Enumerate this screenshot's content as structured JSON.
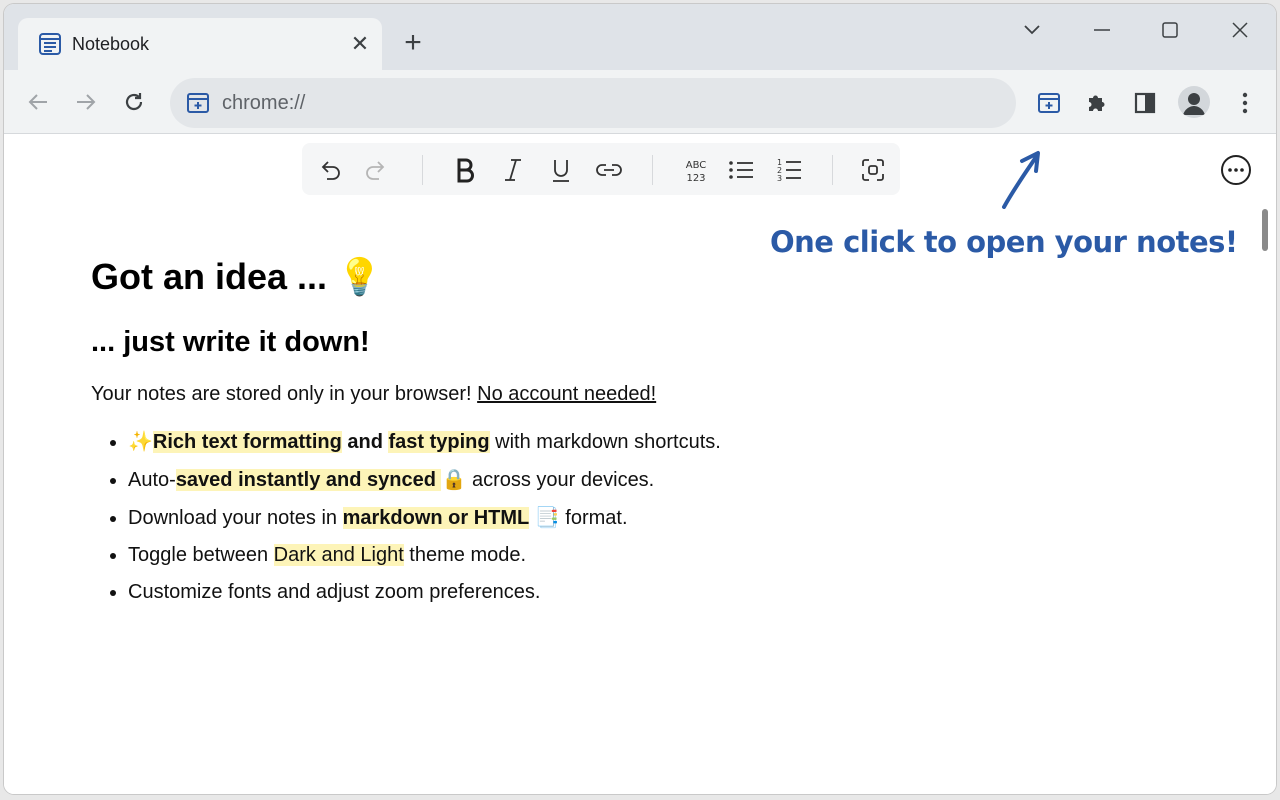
{
  "tab": {
    "title": "Notebook",
    "close_glyph": "✕",
    "new_tab_glyph": "+"
  },
  "omnibox": {
    "url": "chrome://"
  },
  "annotation": {
    "text": "One click to open your notes!"
  },
  "doc": {
    "heading1": "Got an idea ...",
    "heading1_emoji": "💡",
    "heading2": "... just write it down!",
    "paragraph_text": "Your notes are stored only in your browser! ",
    "paragraph_link": "No account needed!",
    "bullets": [
      {
        "emoji": "✨",
        "bold1": "Rich text formatting",
        "and": " and ",
        "bold2": "fast typing",
        "tail": " with markdown shortcuts."
      },
      {
        "lead": "Auto-",
        "bold": "saved instantly and synced",
        "emoji": "🔒",
        "tail": " across your devices."
      },
      {
        "lead": "Download your notes in ",
        "bold": "markdown or HTML",
        "emoji": "📑",
        "tail": " format."
      },
      {
        "lead": "Toggle between ",
        "hl": "Dark and Light",
        "tail": " theme mode."
      },
      {
        "text": "Customize fonts and adjust zoom preferences."
      }
    ]
  },
  "editor_toolbar": {
    "items": [
      "undo-icon",
      "redo-icon",
      "bold-icon",
      "italic-icon",
      "underline-icon",
      "link-icon",
      "spellcheck-icon",
      "bulleted-list-icon",
      "numbered-list-icon",
      "focus-mode-icon"
    ],
    "spellcheck_top": "ABC",
    "spellcheck_bottom": "123"
  },
  "colors": {
    "accent": "#2b5aa6",
    "highlight": "#fdf4b8",
    "tabbar": "#dfe3e8",
    "toolbar": "#f1f3f4"
  }
}
